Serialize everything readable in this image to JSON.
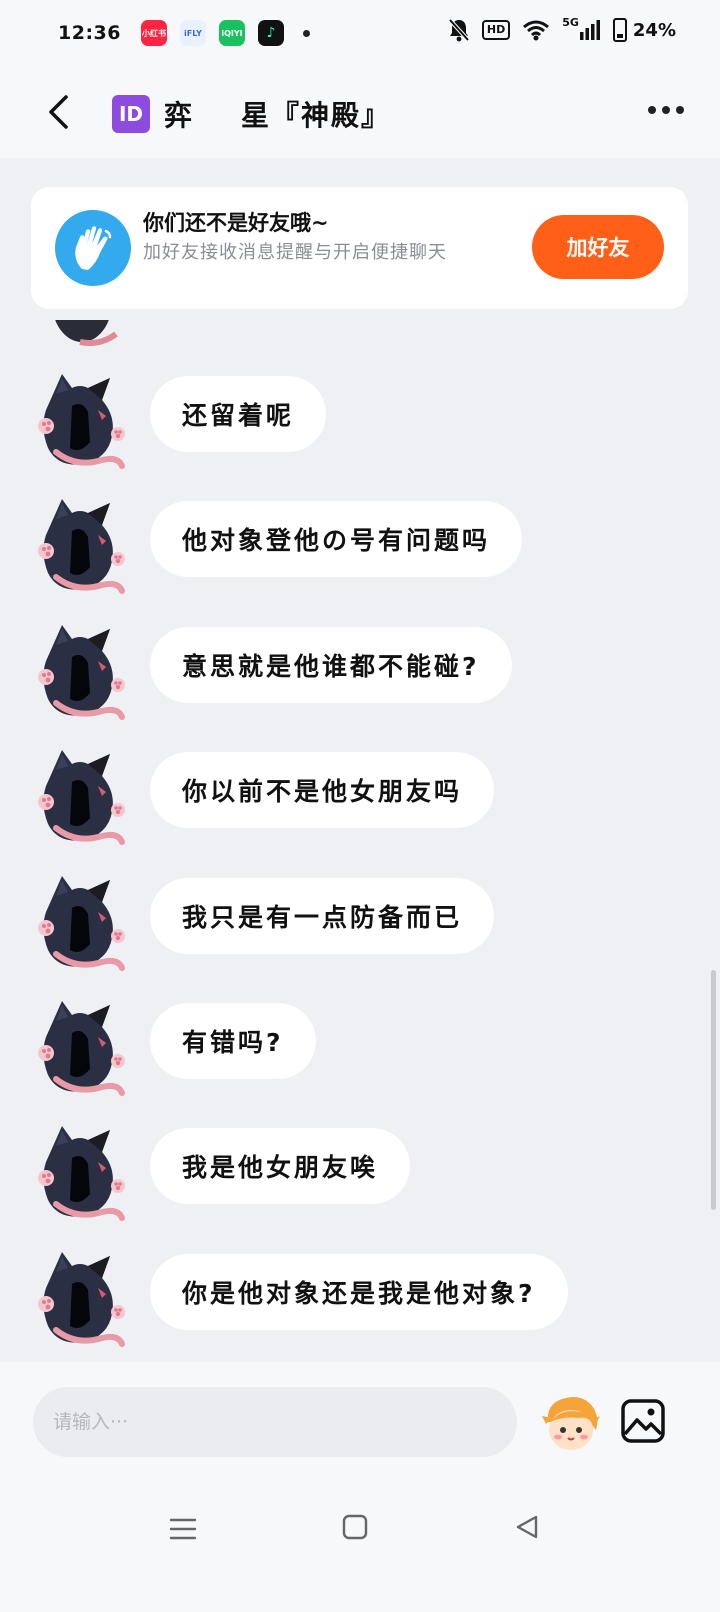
{
  "status_bar": {
    "time": "12:36",
    "apps": [
      {
        "name": "app-icon-red",
        "label": "小红书",
        "color": "#ff2442"
      },
      {
        "name": "app-icon-ifly",
        "label": "iFLY",
        "color": "#e9f1ff"
      },
      {
        "name": "app-icon-iqiyi",
        "label": "iQIYI",
        "color": "#19c15f"
      },
      {
        "name": "app-icon-tiktok",
        "label": "♪",
        "color": "#111111"
      }
    ],
    "hd": "HD",
    "signal": "5G",
    "battery": "24%"
  },
  "header": {
    "id_badge": "ID",
    "title": "弈    星『神殿』"
  },
  "friend_banner": {
    "title": "你们还不是好友哦~",
    "subtitle": "加好友接收消息提醒与开启便捷聊天",
    "button": "加好友",
    "accent": "#ff5f17",
    "icon_color": "#33a9ee"
  },
  "messages": [
    {
      "text": "还留着呢"
    },
    {
      "text": "他对象登他の号有问题吗"
    },
    {
      "text": "意思就是他谁都不能碰?"
    },
    {
      "text": "你以前不是他女朋友吗"
    },
    {
      "text": "我只是有一点防备而已"
    },
    {
      "text": "有错吗?"
    },
    {
      "text": "我是他女朋友唉"
    },
    {
      "text": "你是他对象还是我是他对象?"
    }
  ],
  "composer": {
    "placeholder": "请输入···"
  }
}
